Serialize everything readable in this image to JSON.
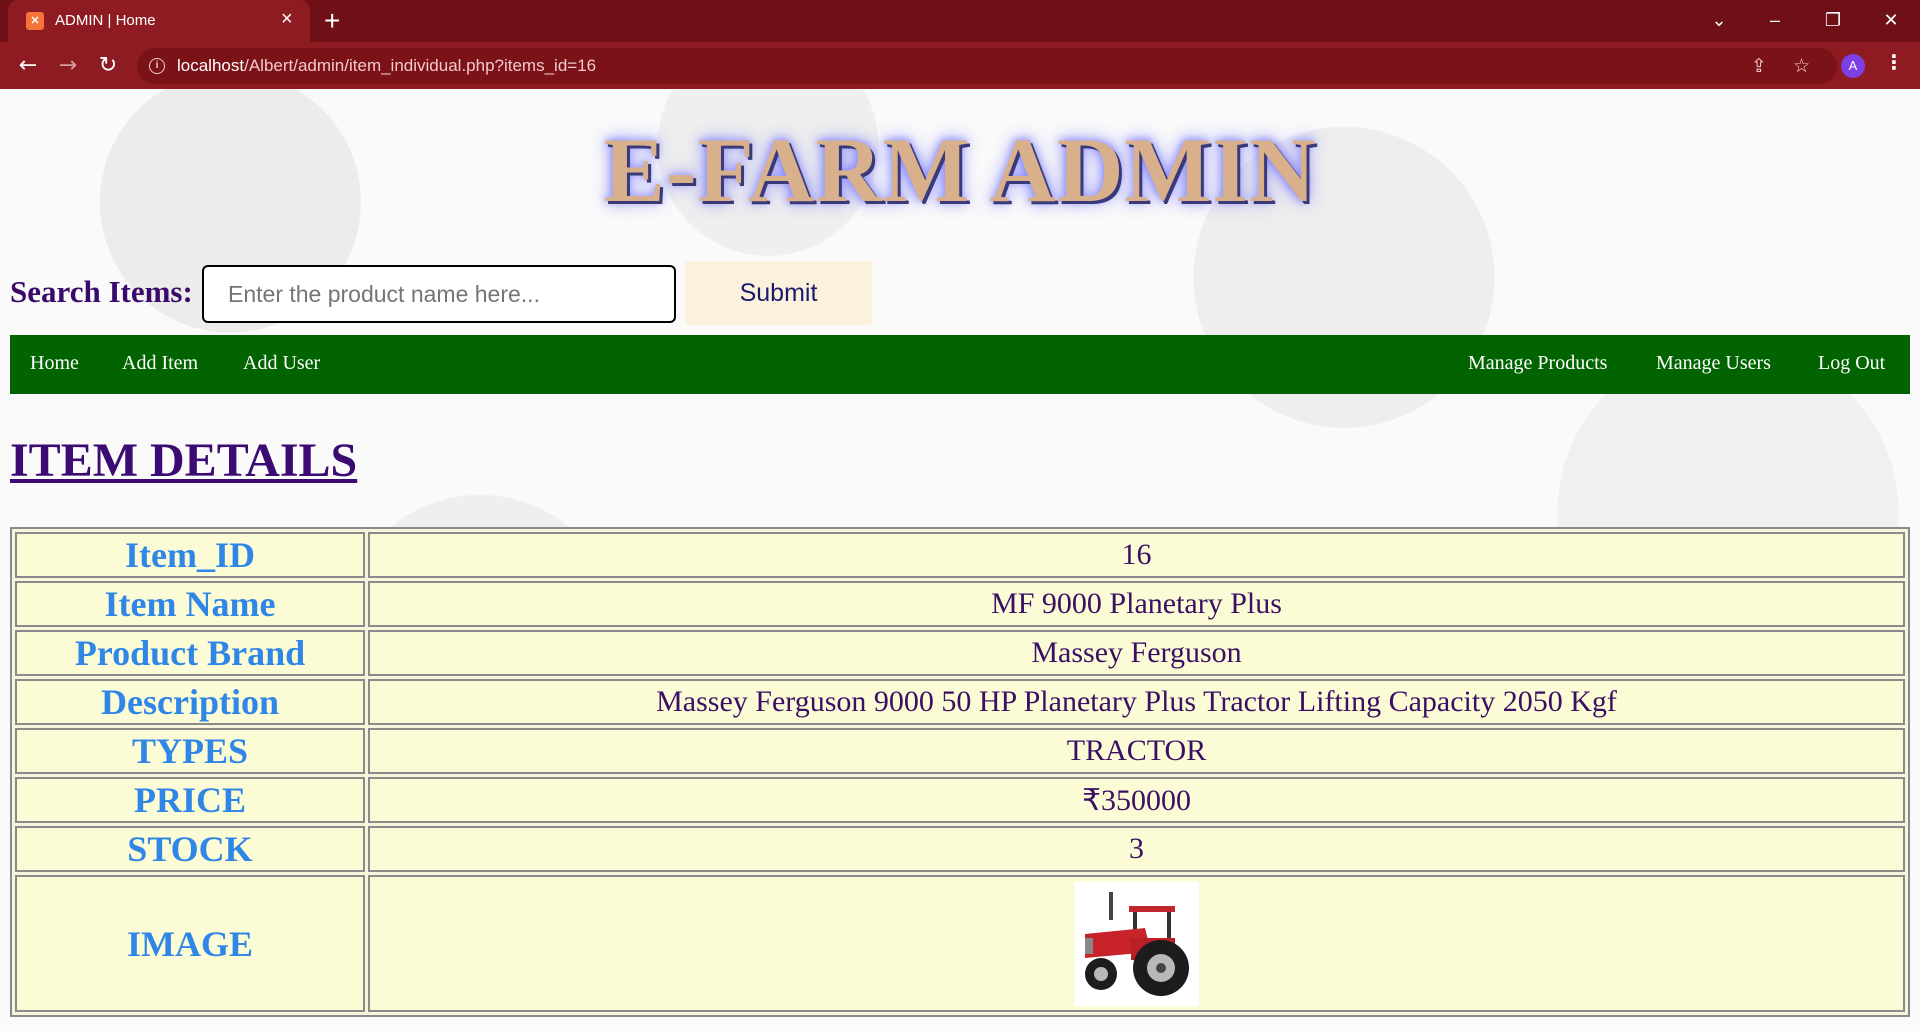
{
  "browser": {
    "tab_title": "ADMIN | Home",
    "tab_favicon": "xampp-favicon-icon",
    "url_host": "localhost",
    "url_path": "/Albert/admin/item_individual.php?items_id=16",
    "profile_initial": "A"
  },
  "header": {
    "brand": "E-FARM ADMIN"
  },
  "search": {
    "label": "Search Items:",
    "placeholder": "Enter the product name here...",
    "value": "",
    "submit_label": "Submit"
  },
  "nav": {
    "left": [
      "Home",
      "Add Item",
      "Add User"
    ],
    "right": [
      "Manage Products",
      "Manage Users",
      "Log Out"
    ]
  },
  "section_title": "ITEM DETAILS",
  "item_details": [
    {
      "key": "Item_ID",
      "value": "16"
    },
    {
      "key": "Item Name",
      "value": "MF 9000 Planetary Plus"
    },
    {
      "key": "Product Brand",
      "value": "Massey Ferguson"
    },
    {
      "key": "Description",
      "value": "Massey Ferguson 9000 50 HP Planetary Plus Tractor Lifting Capacity 2050 Kgf"
    },
    {
      "key": "TYPES",
      "value": "TRACTOR"
    },
    {
      "key": "PRICE",
      "value": "₹350000"
    },
    {
      "key": "STOCK",
      "value": "3"
    },
    {
      "key": "IMAGE",
      "value": ""
    }
  ],
  "colors": {
    "tab_bar": "#6e1015",
    "toolbar": "#8e1b22",
    "navbar": "#016400",
    "key_text": "#2f86e6",
    "value_text": "#3b0f63",
    "table_bg": "#fbfbd6"
  }
}
